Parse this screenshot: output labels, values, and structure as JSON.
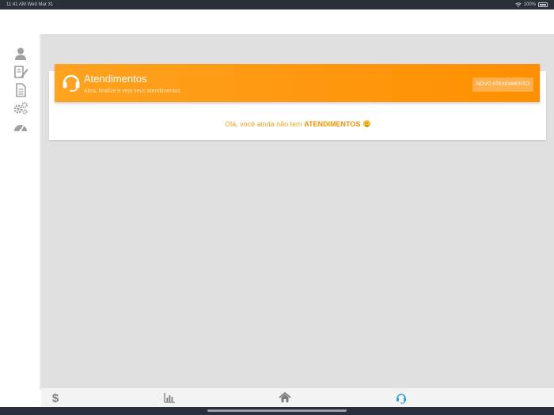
{
  "status_bar": {
    "time_date": "11:41 AM   Wed Mar 31",
    "battery": "100%",
    "icons": [
      "wifi-icon",
      "battery-icon"
    ]
  },
  "sidebar": {
    "items": [
      {
        "icon": "user-icon"
      },
      {
        "icon": "edit-document-icon"
      },
      {
        "icon": "document-icon"
      },
      {
        "icon": "settings-gears-icon"
      },
      {
        "icon": "dashboard-gauge-icon"
      }
    ]
  },
  "banner": {
    "icon": "headset-icon",
    "title": "Atendimentos",
    "subtitle": "Abra, finalize e veja seus atendimentos.",
    "new_button": "NOVO ATENDIMENTO"
  },
  "empty_state": {
    "prefix": "Olá, você ainda não tem ",
    "highlight": "ATENDIMENTOS",
    "emoji": "smiley-emoji"
  },
  "bottom_nav": {
    "items": [
      {
        "icon": "dollar-icon"
      },
      {
        "icon": "bar-chart-icon"
      },
      {
        "icon": "home-icon"
      },
      {
        "icon": "headset-icon",
        "active": true
      }
    ]
  },
  "colors": {
    "accent": "#ff9800",
    "active_nav": "#2aa3d8",
    "background": "#e0e0e0",
    "sidebar_icon": "#9e9e9e"
  }
}
